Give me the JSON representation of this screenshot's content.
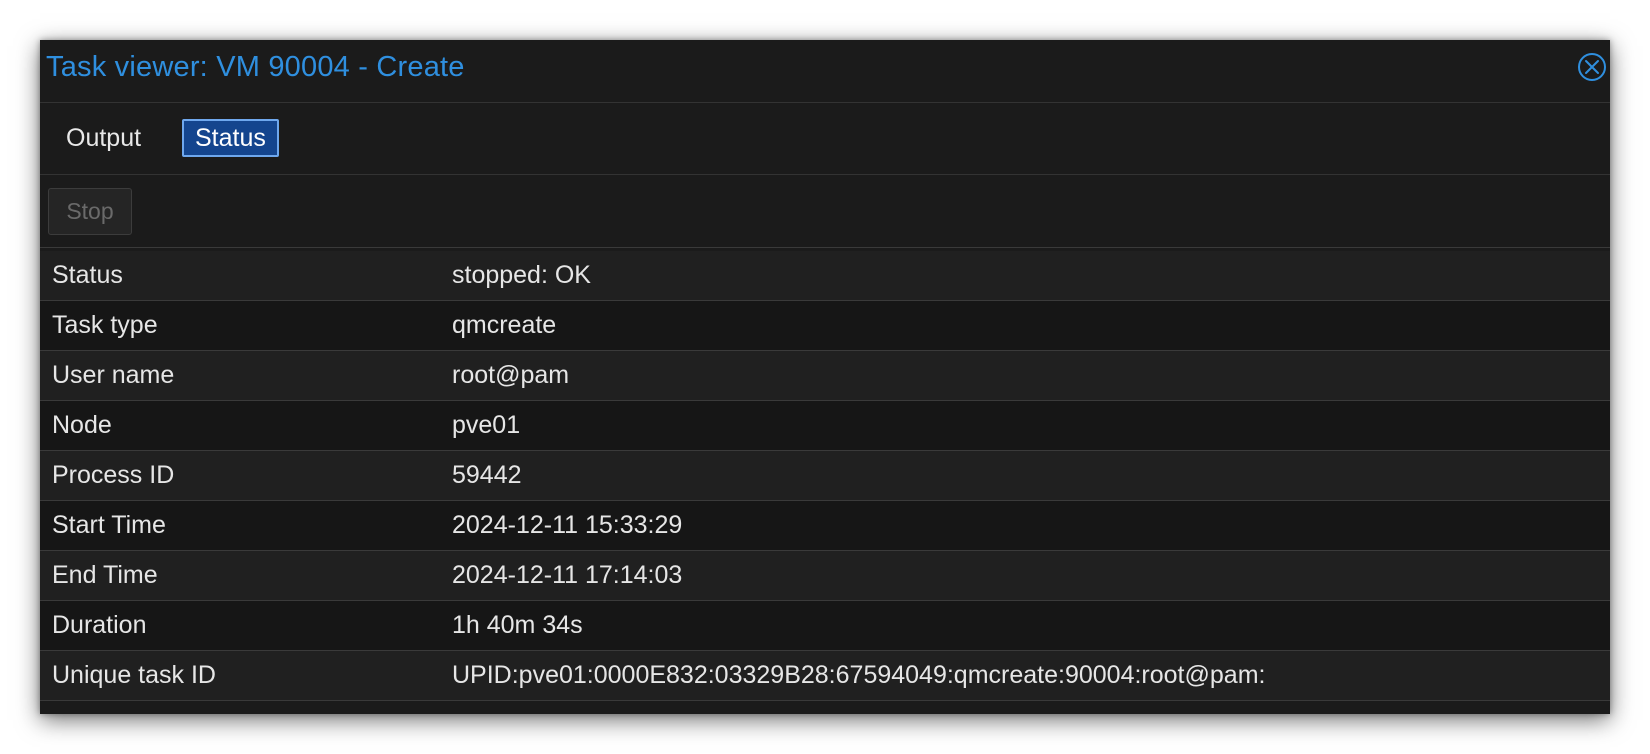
{
  "window": {
    "title": "Task viewer: VM 90004 - Create"
  },
  "tabs": [
    {
      "label": "Output",
      "active": false
    },
    {
      "label": "Status",
      "active": true
    }
  ],
  "toolbar": {
    "stop_label": "Stop",
    "stop_disabled": true
  },
  "rows": [
    {
      "key": "Status",
      "value": "stopped: OK"
    },
    {
      "key": "Task type",
      "value": "qmcreate"
    },
    {
      "key": "User name",
      "value": "root@pam"
    },
    {
      "key": "Node",
      "value": "pve01"
    },
    {
      "key": "Process ID",
      "value": "59442"
    },
    {
      "key": "Start Time",
      "value": "2024-12-11 15:33:29"
    },
    {
      "key": "End Time",
      "value": "2024-12-11 17:14:03"
    },
    {
      "key": "Duration",
      "value": "1h 40m 34s"
    },
    {
      "key": "Unique task ID",
      "value": "UPID:pve01:0000E832:03329B28:67594049:qmcreate:90004:root@pam:"
    }
  ],
  "colors": {
    "accent": "#2f8fdf",
    "active_tab_bg": "#14458e",
    "panel_bg": "#1b1b1b"
  },
  "icons": {
    "close": "close-icon"
  }
}
